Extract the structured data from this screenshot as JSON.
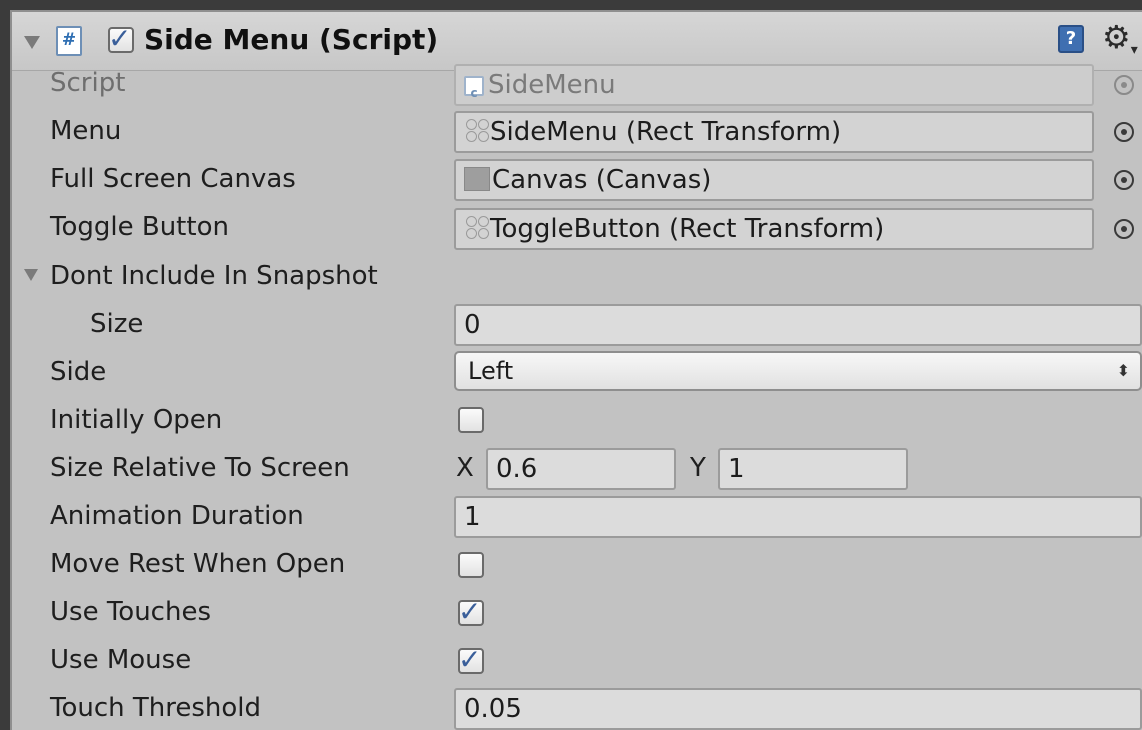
{
  "component": {
    "title": "Side Menu (Script)",
    "enabled": true,
    "script_icon_glyph": "#",
    "help_glyph": "?",
    "gear_glyph": "⚙",
    "gear_caret": "▾"
  },
  "rows": {
    "script": {
      "label": "Script",
      "value": "SideMenu",
      "icon": "cs-script-icon"
    },
    "menu": {
      "label": "Menu",
      "value": "SideMenu (Rect Transform)",
      "icon": "rect-transform-icon"
    },
    "full_screen_canvas": {
      "label": "Full Screen Canvas",
      "value": "Canvas (Canvas)",
      "icon": "canvas-icon"
    },
    "toggle_button": {
      "label": "Toggle Button",
      "value": "ToggleButton (Rect Transform)",
      "icon": "rect-transform-icon"
    },
    "dont_include": {
      "label": "Dont Include In Snapshot"
    },
    "size": {
      "label": "Size",
      "value": "0"
    },
    "side": {
      "label": "Side",
      "value": "Left",
      "arrows": "⬍"
    },
    "initially_open": {
      "label": "Initially Open",
      "checked": false
    },
    "size_relative": {
      "label": "Size Relative To Screen",
      "x_label": "X",
      "x_value": "0.6",
      "y_label": "Y",
      "y_value": "1"
    },
    "animation_duration": {
      "label": "Animation Duration",
      "value": "1"
    },
    "move_rest": {
      "label": "Move Rest When Open",
      "checked": false
    },
    "use_touches": {
      "label": "Use Touches",
      "checked": true
    },
    "use_mouse": {
      "label": "Use Mouse",
      "checked": true
    },
    "touch_threshold": {
      "label": "Touch Threshold",
      "value": "0.05"
    }
  },
  "colors": {
    "panel_bg": "#c2c2c2",
    "check_blue": "#3a5f9a",
    "help_blue": "#3f6fb1"
  }
}
